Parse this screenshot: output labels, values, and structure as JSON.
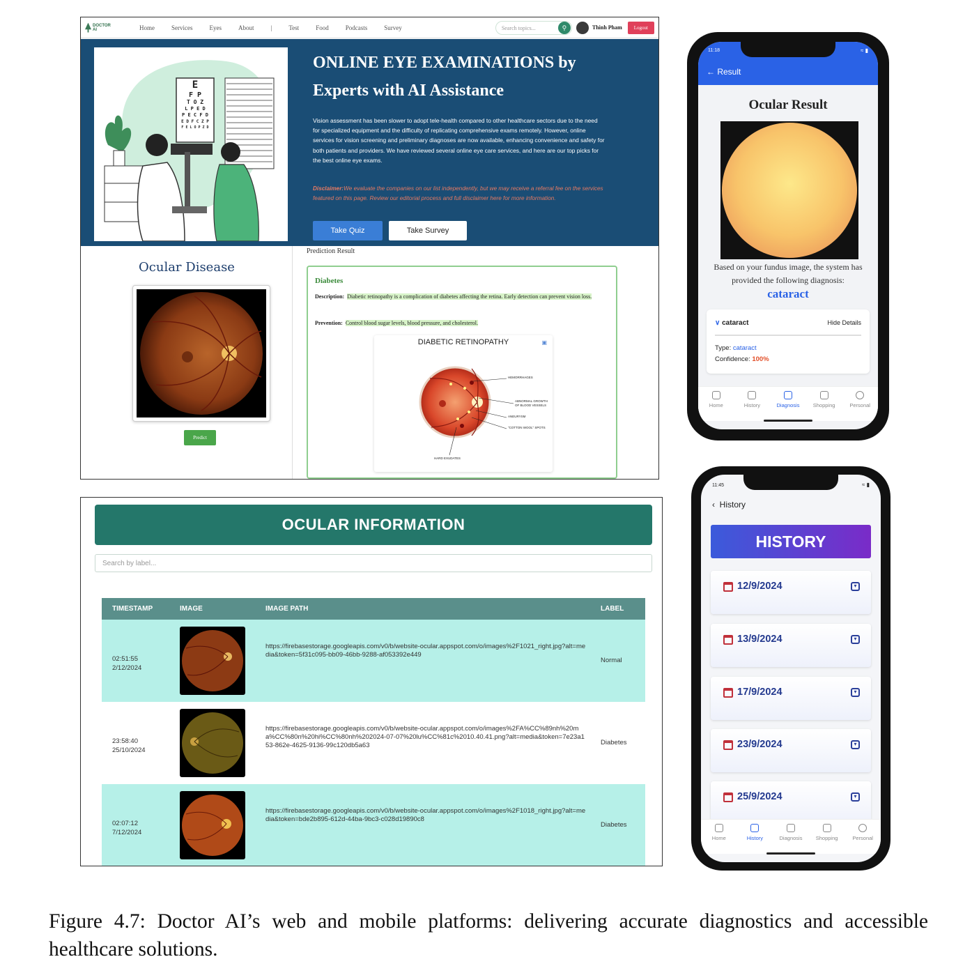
{
  "web1": {
    "nav": {
      "logo": "DOCTOR AI",
      "menu": [
        "Home",
        "Services",
        "Eyes",
        "About",
        "|",
        "Test",
        "Food",
        "Podcasts",
        "Survey"
      ],
      "search_placeholder": "Search topics...",
      "user": "Thinh Pham",
      "logout": "Logout"
    },
    "hero": {
      "title_line1": "ONLINE EYE EXAMINATIONS by",
      "title_line2": "Experts with AI Assistance",
      "text": "Vision assessment has been slower to adopt tele-health compared to other healthcare sectors due to the need for specialized equipment and the difficulty of replicating comprehensive exams remotely. However, online services for vision screening and preliminary diagnoses are now available, enhancing convenience and safety for both patients and providers. We have reviewed several online eye care services, and here are our top picks for the best online eye exams.",
      "disclaimer_label": "Disclaimer:",
      "disclaimer": "We evaluate the companies on our list independently, but we may receive a referral fee on the services featured on this page. Review our editorial process and full disclaimer here for more information.",
      "btn_quiz": "Take Quiz",
      "btn_survey": "Take Survey",
      "eye_chart": [
        "E",
        "F P",
        "T O Z",
        "L P E D",
        "P E C F D",
        "E D F C Z P",
        "F E L O P Z D"
      ]
    },
    "left": {
      "title": "Ocular Disease",
      "predict": "Predict"
    },
    "result": {
      "label": "Prediction Result",
      "disease": "Diabetes",
      "desc_label": "Description:",
      "desc": "Diabetic retinopathy is a complication of diabetes affecting the retina. Early detection can prevent vision loss.",
      "prev_label": "Prevention:",
      "prev": "Control blood sugar levels, blood pressure, and cholesterol.",
      "figure_title": "DIABETIC RETINOPATHY",
      "figure_labels": [
        "HEMORRHAGES",
        "ABNORMAL GROWTH",
        "OF BLOOD VESSELS",
        "ANEURYSM",
        "\"COTTON WOOL\" SPOTS",
        "HARD EXUDATES"
      ]
    }
  },
  "web2": {
    "title": "OCULAR INFORMATION",
    "search_placeholder": "Search by label...",
    "columns": [
      "TIMESTAMP",
      "IMAGE",
      "IMAGE PATH",
      "LABEL"
    ],
    "rows": [
      {
        "time": "02:51:55",
        "date": "2/12/2024",
        "path": "https://firebasestorage.googleapis.com/v0/b/website-ocular.appspot.com/o/images%2F1021_right.jpg?alt=media&token=5f31c095-bb09-46bb-9288-af053392e449",
        "label": "Normal"
      },
      {
        "time": "23:58:40",
        "date": "25/10/2024",
        "path": "https://firebasestorage.googleapis.com/v0/b/website-ocular.appspot.com/o/images%2FA%CC%89nh%20ma%CC%80n%20hi%CC%80nh%202024-07-07%20lu%CC%81c%2010.40.41.png?alt=media&token=7e23a153-862e-4625-9136-99c120db5a63",
        "label": "Diabetes"
      },
      {
        "time": "02:07:12",
        "date": "7/12/2024",
        "path": "https://firebasestorage.googleapis.com/v0/b/website-ocular.appspot.com/o/images%2F1018_right.jpg?alt=media&token=bde2b895-612d-44ba-9bc3-c028d19890c8",
        "label": "Diabetes"
      }
    ]
  },
  "phone1": {
    "time": "11:18",
    "back": "Result",
    "title": "Ocular Result",
    "text": "Based on your fundus image, the system has provided the following diagnosis:",
    "diagnosis": "cataract",
    "card": {
      "header": "cataract",
      "hide": "Hide Details",
      "type_label": "Type:",
      "type_value": "cataract",
      "conf_label": "Confidence:",
      "conf_value": "100%"
    },
    "tabs": [
      "Home",
      "History",
      "Diagnosis",
      "Shopping",
      "Personal"
    ],
    "active_tab": "Diagnosis"
  },
  "phone2": {
    "time": "11:45",
    "back": "History",
    "banner": "HISTORY",
    "dates": [
      "12/9/2024",
      "13/9/2024",
      "17/9/2024",
      "23/9/2024",
      "25/9/2024"
    ],
    "tabs": [
      "Home",
      "History",
      "Diagnosis",
      "Shopping",
      "Personal"
    ],
    "active_tab": "History"
  },
  "caption": "Figure 4.7: Doctor AI’s web and mobile platforms: delivering accurate diagnostics and accessible healthcare solutions.",
  "colors": {
    "hero_bg": "#1a4d75",
    "teal_header": "#24776a",
    "row_teal": "#b6f0e8",
    "phone_blue": "#2a62e6",
    "history_gradient_start": "#3b5bdb",
    "history_gradient_end": "#7a2bc8",
    "confidence": "#e2502a"
  }
}
